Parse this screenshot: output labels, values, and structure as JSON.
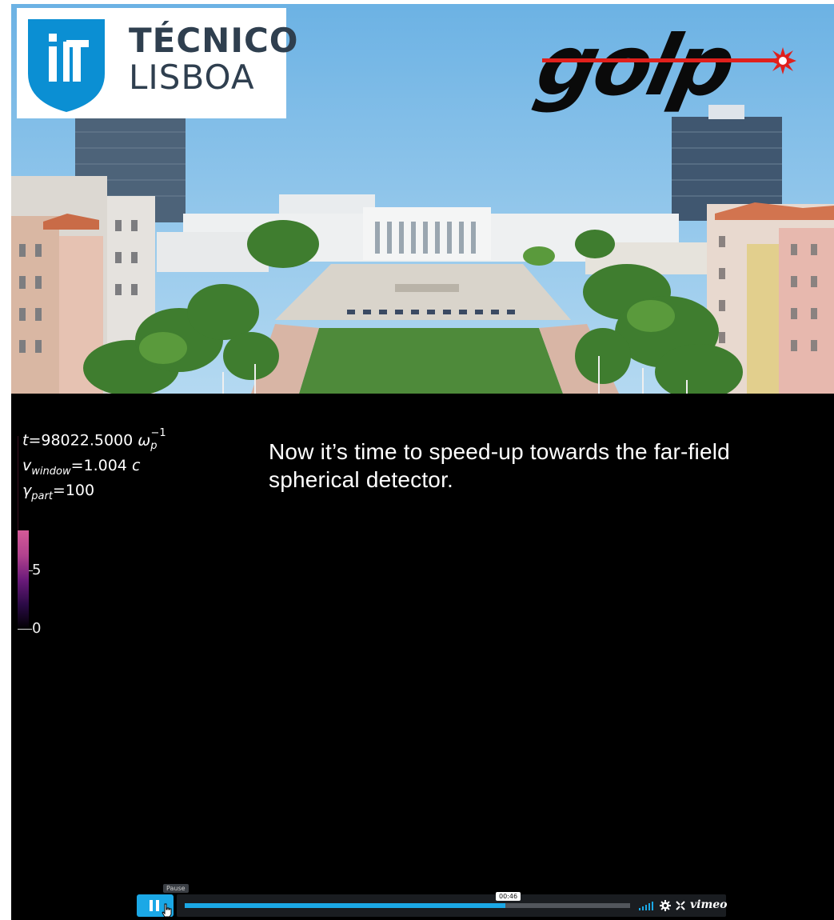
{
  "logos": {
    "ist_line1": "TÉCNICO",
    "ist_line2": "LISBOA",
    "golp_text": "golp"
  },
  "annotations": {
    "time": {
      "var": "t",
      "value": "=98022.5000",
      "unit": "ω",
      "unit_sub": "p",
      "unit_sup": "−1"
    },
    "window": {
      "var": "v",
      "sub": "window",
      "value": "=1.004",
      "unit": "c"
    },
    "gamma": {
      "var": "γ",
      "sub": "part",
      "value": "=100"
    }
  },
  "colorbar": {
    "tick_high": "5",
    "tick_low": "0",
    "colors": [
      "#d45a98",
      "#6a1a7a",
      "#000000"
    ]
  },
  "caption": "Now it’s time to speed-up towards the far-field spherical detector.",
  "player": {
    "pause_tooltip": "Pause",
    "time_tooltip": "00:46",
    "progress_fraction": 0.72,
    "brand": "vimeo",
    "accent_color": "#1ba8e6",
    "icons": [
      "pause-icon",
      "volume-icon",
      "gear-icon",
      "fullscreen-icon"
    ]
  }
}
